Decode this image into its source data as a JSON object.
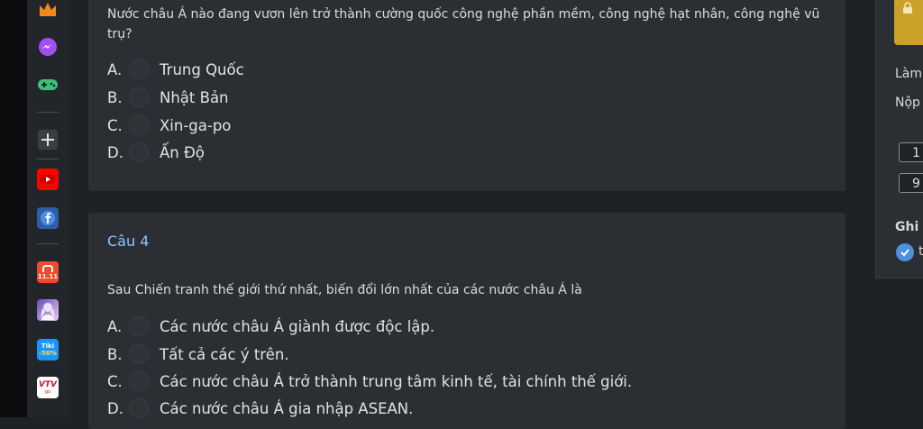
{
  "question3": {
    "text": "Nước châu Á nào đang vươn lên trở thành cường quốc công nghệ phần mềm, công nghệ hạt nhân, công nghệ vũ trụ?",
    "options": [
      {
        "letter": "A.",
        "text": "Trung Quốc"
      },
      {
        "letter": "B.",
        "text": "Nhật Bản"
      },
      {
        "letter": "C.",
        "text": "Xin-ga-po"
      },
      {
        "letter": "D.",
        "text": "Ấn Độ"
      }
    ]
  },
  "question4": {
    "title": "Câu 4",
    "text": "Sau Chiến tranh thế giới thứ nhất, biến đổi lớn nhất của các nước châu Á là",
    "options": [
      {
        "letter": "A.",
        "text": "Các nước châu Á giành được độc lập."
      },
      {
        "letter": "B.",
        "text": "Tất cả các ý trên."
      },
      {
        "letter": "C.",
        "text": "Các nước châu Á trở thành trung tâm kinh tế, tài chính thế giới."
      },
      {
        "letter": "D.",
        "text": "Các nước châu Á gia nhập ASEAN."
      }
    ]
  },
  "right_panel": {
    "lam": "Làm",
    "nop": "Nộp",
    "box1": "1",
    "box2": "9",
    "ghi": "Ghi",
    "check_tail": "t"
  },
  "sidebar": {
    "shopee_badge": "11.11",
    "tiki_text": "Tiki",
    "tiki_discount": "-50%",
    "vtv_text": "VTV",
    "vtv_sub": "go"
  },
  "colors": {
    "accent_blue": "#8cc4ff",
    "lock_yellow": "#c9a227",
    "check_blue": "#4f8fe0"
  }
}
